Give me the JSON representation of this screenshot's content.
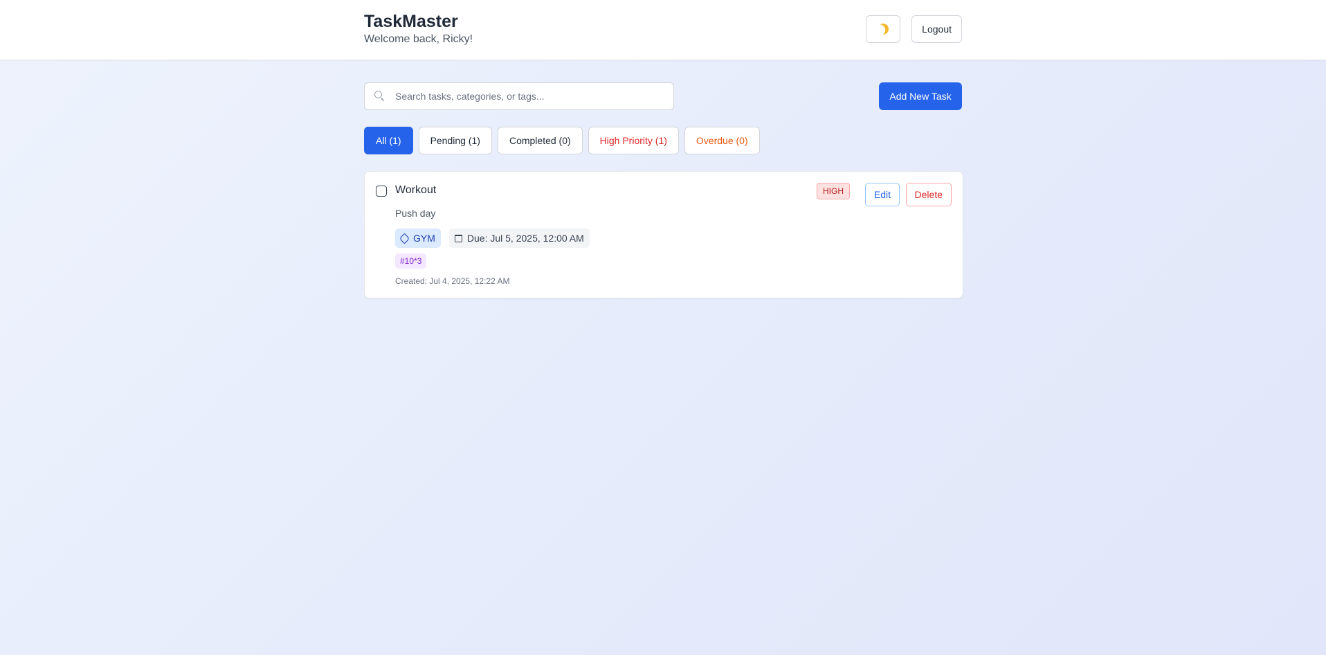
{
  "app": {
    "title": "TaskMaster",
    "welcome": "Welcome back, Ricky!"
  },
  "header": {
    "theme_icon": "moon-icon",
    "logout_label": "Logout"
  },
  "search": {
    "placeholder": "Search tasks, categories, or tags...",
    "value": ""
  },
  "toolbar": {
    "add_label": "Add New Task"
  },
  "filters": [
    {
      "label": "All (1)",
      "active": true
    },
    {
      "label": "Pending (1)",
      "active": false
    },
    {
      "label": "Completed (0)",
      "active": false
    },
    {
      "label": "High Priority (1)",
      "active": false
    },
    {
      "label": "Overdue (0)",
      "active": false
    }
  ],
  "tasks": [
    {
      "title": "Workout",
      "description": "Push day",
      "category": "GYM",
      "due": "Due: Jul 5, 2025, 12:00 AM",
      "tag": "#10*3",
      "created": "Created: Jul 4, 2025, 12:22 AM",
      "priority": "HIGH",
      "completed": false,
      "edit_label": "Edit",
      "delete_label": "Delete"
    }
  ],
  "colors": {
    "primary": "#2563eb",
    "danger": "#dc2626",
    "warning": "#ea580c"
  }
}
